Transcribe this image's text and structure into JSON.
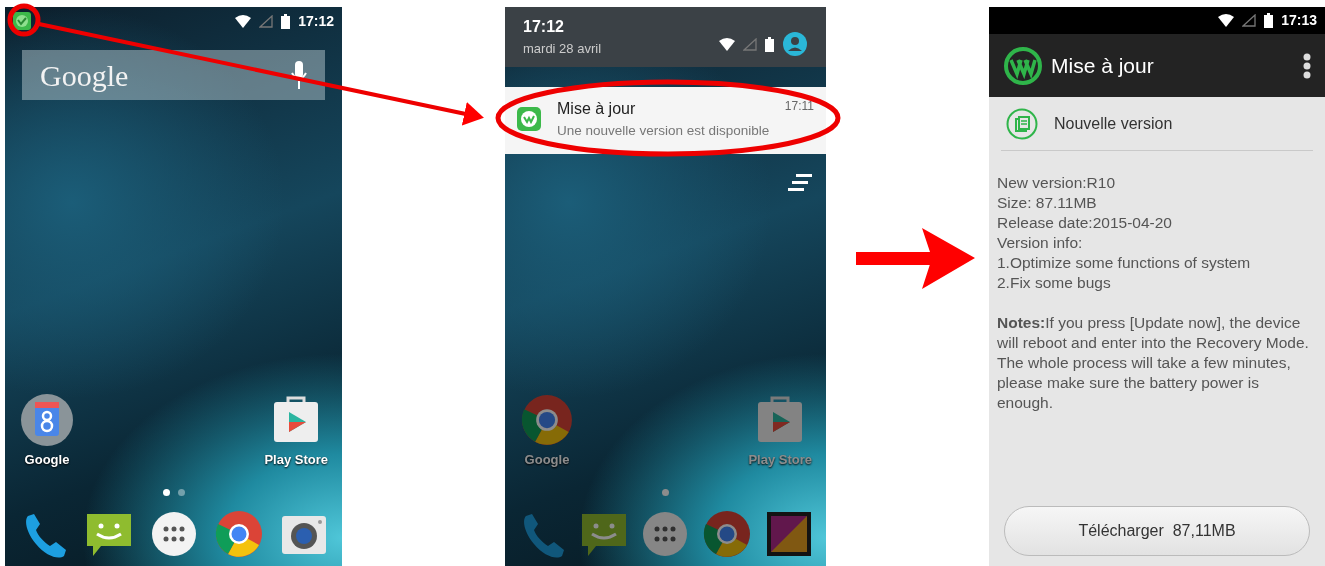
{
  "screens": [
    {
      "kind": "home",
      "status_bar": {
        "time": "17:12"
      },
      "search": {
        "label": "Google"
      },
      "shortcuts": [
        {
          "label": "Google"
        },
        {
          "label": "Play Store"
        }
      ],
      "pages": [
        {
          "selected": true
        },
        {
          "selected": false
        }
      ]
    },
    {
      "kind": "shade",
      "header": {
        "time": "17:12",
        "date": "mardi 28 avril"
      },
      "notification": {
        "title": "Mise à jour",
        "time": "17:11",
        "text": "Une nouvelle version est disponible"
      },
      "shortcuts": [
        {
          "label": "Google"
        },
        {
          "label": "Play Store"
        }
      ],
      "pages": [
        {
          "selected": true
        }
      ]
    },
    {
      "kind": "app",
      "status_bar": {
        "time": "17:13"
      },
      "app_bar": {
        "title": "Mise à jour"
      },
      "section": {
        "title": "Nouvelle version"
      },
      "details": [
        "New version:R10",
        "Size: 87.11MB",
        "Release date:2015-04-20",
        "Version info:",
        "1.Optimize some functions of system",
        "2.Fix some bugs"
      ],
      "notes": "**Notes:**If you press [Update now], the device will reboot and enter into the Recovery Mode. The whole process will take a few minutes, please make sure the battery power is enough.",
      "button": "Télécharger  87,11MB"
    }
  ]
}
